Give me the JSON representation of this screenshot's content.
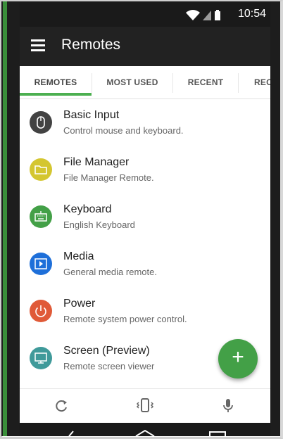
{
  "status_bar": {
    "time": "10:54",
    "icons": [
      "wifi-icon",
      "signal-icon",
      "battery-icon"
    ]
  },
  "app_bar": {
    "title": "Remotes",
    "menu_icon": "menu-icon"
  },
  "tabs": [
    {
      "label": "REMOTES",
      "selected": true
    },
    {
      "label": "MOST USED",
      "selected": false
    },
    {
      "label": "RECENT",
      "selected": false
    },
    {
      "label": "REC",
      "selected": false
    }
  ],
  "remotes": [
    {
      "title": "Basic Input",
      "subtitle": "Control mouse and keyboard.",
      "icon": "mouse-icon",
      "color": "#424242"
    },
    {
      "title": "File Manager",
      "subtitle": "File Manager Remote.",
      "icon": "folder-icon",
      "color": "#d4c630"
    },
    {
      "title": "Keyboard",
      "subtitle": "English Keyboard",
      "icon": "keyboard-icon",
      "color": "#43a047"
    },
    {
      "title": "Media",
      "subtitle": "General media remote.",
      "icon": "media-play-icon",
      "color": "#1e6fd9"
    },
    {
      "title": "Power",
      "subtitle": "Remote system power control.",
      "icon": "power-icon",
      "color": "#e05a38"
    },
    {
      "title": "Screen (Preview)",
      "subtitle": "Remote screen viewer",
      "icon": "monitor-icon",
      "color": "#3f9a9a"
    }
  ],
  "fab": {
    "icon": "plus-icon",
    "label": "+",
    "color": "#43a047"
  },
  "bottom_bar": {
    "icons": [
      "refresh-icon",
      "phone-vibrate-icon",
      "microphone-icon"
    ]
  },
  "colors": {
    "accent": "#4caf50",
    "app_bar": "#222222",
    "status_bar": "#1a1a1a"
  }
}
